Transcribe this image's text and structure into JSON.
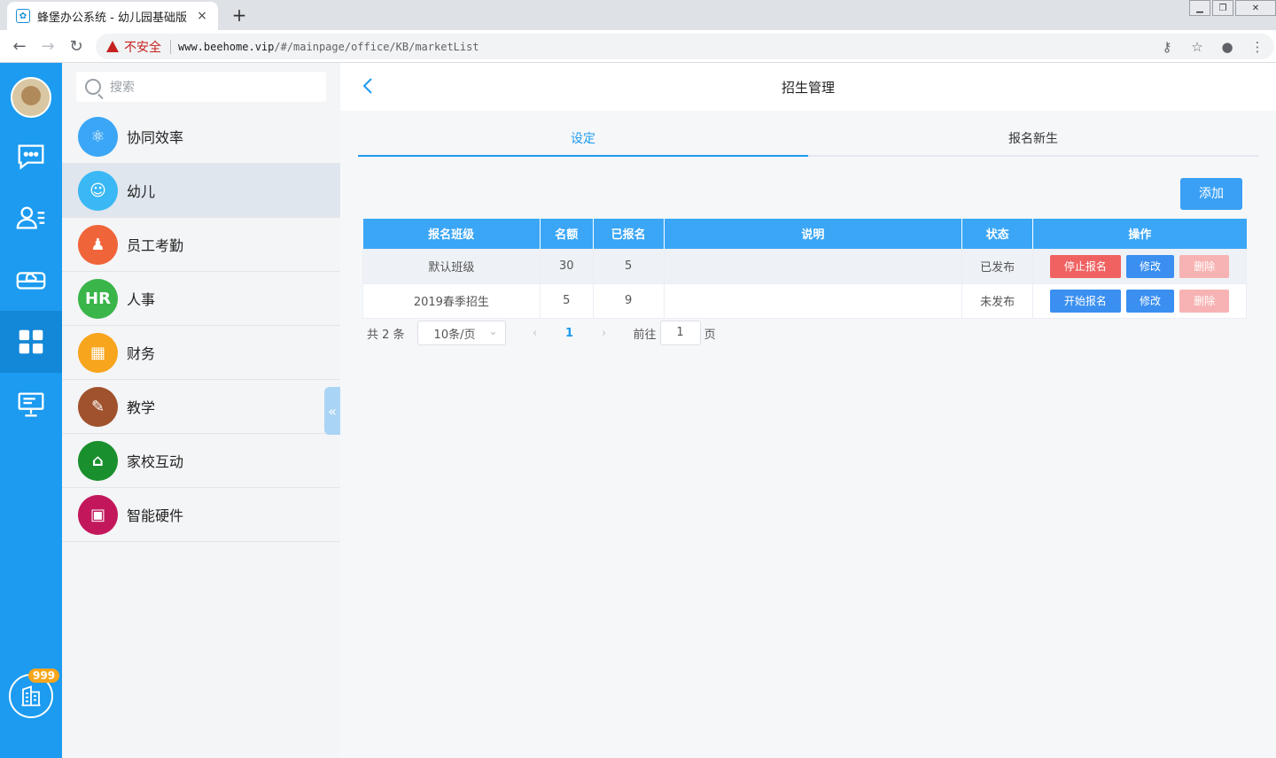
{
  "browser": {
    "tab_title": "蜂堡办公系统 - 幼儿园基础版",
    "tab_close": "×",
    "new_tab": "+",
    "security_label": "不安全",
    "url_host": "www.beehome.vip",
    "url_path": "/#/mainpage/office/KB/marketList"
  },
  "rail": {
    "badge_count": "999",
    "active_index": 3
  },
  "modules": {
    "search_placeholder": "搜索",
    "items": [
      {
        "label": "协同效率",
        "color": "#3aa6f5",
        "icon": "atom-icon"
      },
      {
        "label": "幼儿",
        "color": "#3ab8f5",
        "icon": "smiley-icon"
      },
      {
        "label": "员工考勤",
        "color": "#f0643a",
        "icon": "staff-icon"
      },
      {
        "label": "人事",
        "color": "#3ab54a",
        "icon": "hr-icon"
      },
      {
        "label": "财务",
        "color": "#f7a51c",
        "icon": "finance-icon"
      },
      {
        "label": "教学",
        "color": "#a0522d",
        "icon": "teacher-icon"
      },
      {
        "label": "家校互动",
        "color": "#1a8f2e",
        "icon": "home-icon"
      },
      {
        "label": "智能硬件",
        "color": "#c2185b",
        "icon": "device-icon"
      }
    ],
    "active_index": 1
  },
  "main": {
    "title": "招生管理",
    "tabs": [
      "设定",
      "报名新生"
    ],
    "active_tab": 0,
    "add_label": "添加",
    "table": {
      "headers": [
        "报名班级",
        "名额",
        "已报名",
        "说明",
        "状态",
        "操作"
      ],
      "rows": [
        {
          "class": "默认班级",
          "quota": "30",
          "enrolled": "5",
          "note": "",
          "status": "已发布",
          "toggle": "停止报名",
          "edit": "修改",
          "delete": "删除"
        },
        {
          "class": "2019春季招生",
          "quota": "5",
          "enrolled": "9",
          "note": "",
          "status": "未发布",
          "toggle": "开始报名",
          "edit": "修改",
          "delete": "删除"
        }
      ]
    },
    "pager": {
      "total": "共 2 条",
      "page_size": "10条/页",
      "current": "1",
      "goto_label": "前往",
      "goto_value": "1",
      "page_unit": "页"
    }
  }
}
